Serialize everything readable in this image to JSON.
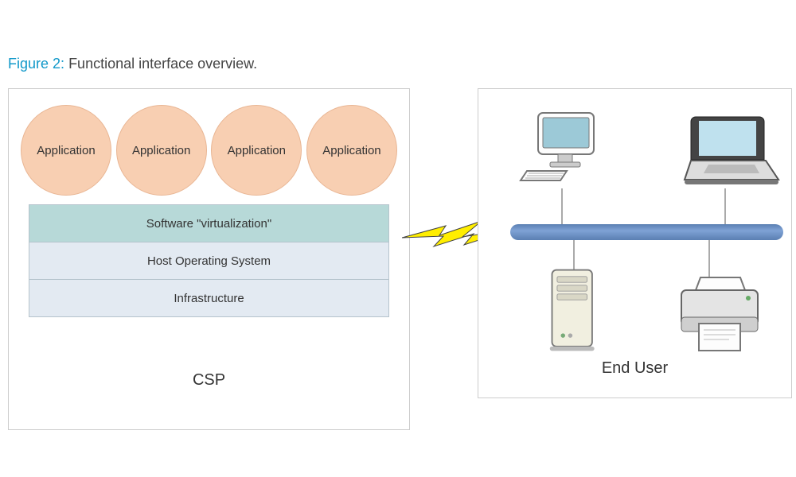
{
  "caption": {
    "figureLabel": "Figure 2:",
    "title": "Functional interface overview."
  },
  "csp": {
    "label": "CSP",
    "applications": [
      "Application",
      "Application",
      "Application",
      "Application"
    ],
    "layers": {
      "virtualization": "Software \"virtualization\"",
      "hostOS": "Host Operating System",
      "infrastructure": "Infrastructure"
    }
  },
  "endUser": {
    "label": "End User",
    "devices": [
      "desktop-pc",
      "laptop",
      "server",
      "printer"
    ]
  },
  "connector": "lightning-bolt"
}
